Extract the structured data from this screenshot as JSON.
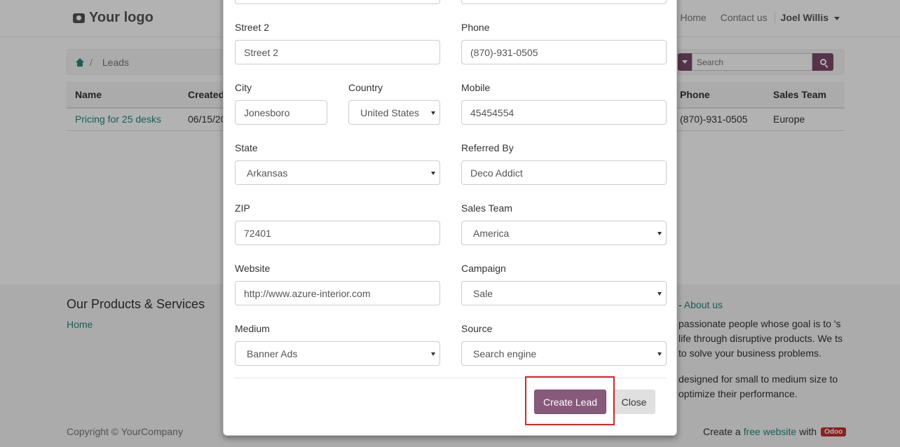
{
  "navbar": {
    "logo_text": "Your logo",
    "links": [
      "Home",
      "Contact us"
    ],
    "user_name": "Joel Willis"
  },
  "breadcrumb": {
    "current": "Leads",
    "separator": "/"
  },
  "search": {
    "placeholder": "Search"
  },
  "table": {
    "headers": [
      "Name",
      "Created",
      "Phone",
      "Sales Team"
    ],
    "rows": [
      {
        "name": "Pricing for 25 desks",
        "created": "06/15/20",
        "phone": "(870)-931-0505",
        "sales_team": "Europe"
      }
    ]
  },
  "footer": {
    "products_title": "Our Products & Services",
    "home_link": "Home",
    "about_prefix": "-",
    "about_link": "About us",
    "para1": "passionate people whose goal is to 's life through disruptive products. We ts to solve your business problems.",
    "para2": "designed for small to medium size to optimize their performance.",
    "copyright": "Copyright © YourCompany",
    "powered_prefix": "Create a",
    "powered_link": "free website",
    "powered_suffix": "with",
    "badge": "Odoo"
  },
  "modal": {
    "fields": {
      "street2": {
        "label": "Street 2",
        "value": "Street 2"
      },
      "phone": {
        "label": "Phone",
        "value": "(870)-931-0505"
      },
      "city": {
        "label": "City",
        "value": "Jonesboro"
      },
      "country": {
        "label": "Country",
        "value": "United States"
      },
      "mobile": {
        "label": "Mobile",
        "value": "45454554"
      },
      "state": {
        "label": "State",
        "value": "Arkansas"
      },
      "referred_by": {
        "label": "Referred By",
        "value": "Deco Addict"
      },
      "zip": {
        "label": "ZIP",
        "value": "72401"
      },
      "sales_team": {
        "label": "Sales Team",
        "value": "America"
      },
      "website": {
        "label": "Website",
        "value": "http://www.azure-interior.com"
      },
      "campaign": {
        "label": "Campaign",
        "value": "Sale"
      },
      "medium": {
        "label": "Medium",
        "value": "Banner Ads"
      },
      "source": {
        "label": "Source",
        "value": "Search engine"
      }
    },
    "create_label": "Create Lead",
    "close_label": "Close"
  },
  "colors": {
    "primary": "#875a7b",
    "link": "#1f8a80",
    "highlight": "#d9262b"
  }
}
